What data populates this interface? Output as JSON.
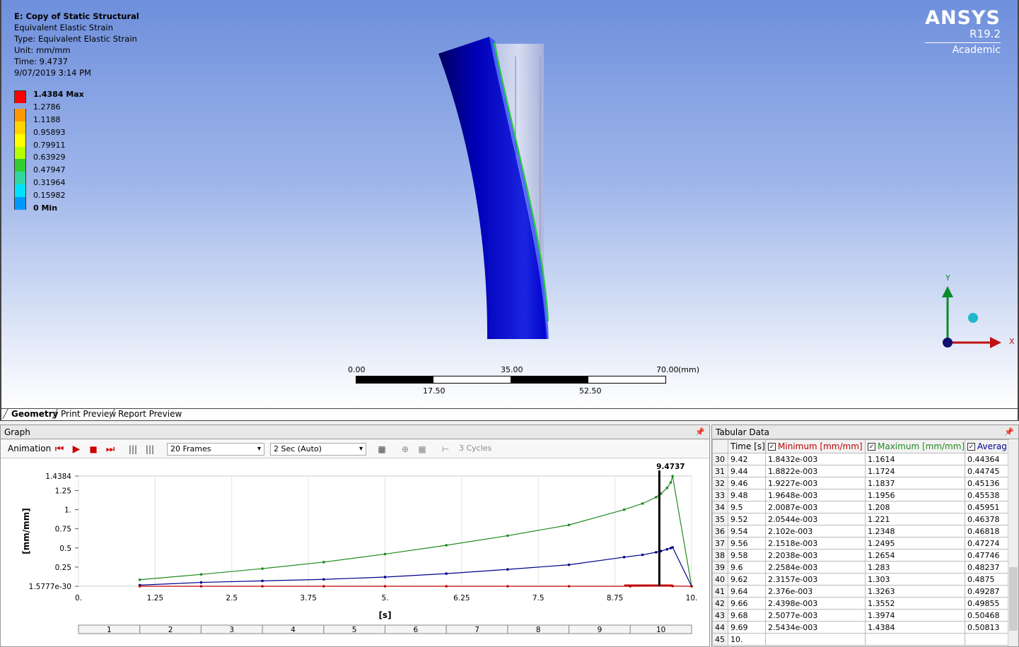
{
  "viewport": {
    "title": "E: Copy of Static Structural",
    "result": "Equivalent Elastic Strain",
    "type": "Type: Equivalent Elastic Strain",
    "unit": "Unit: mm/mm",
    "time": "Time: 9.4737",
    "date": "9/07/2019 3:14 PM",
    "legend": [
      {
        "label": "1.4384 Max",
        "color": "#ff0000",
        "bold": true
      },
      {
        "label": "1.2786",
        "color": "#ff9900"
      },
      {
        "label": "1.1188",
        "color": "#ffd400"
      },
      {
        "label": "0.95893",
        "color": "#ffff00"
      },
      {
        "label": "0.79911",
        "color": "#b4ff00"
      },
      {
        "label": "0.63929",
        "color": "#33cc33"
      },
      {
        "label": "0.47947",
        "color": "#33d6a3"
      },
      {
        "label": "0.31964",
        "color": "#00e1ff"
      },
      {
        "label": "0.15982",
        "color": "#0099ff"
      },
      {
        "label": "0 Min",
        "color": "#0000ff",
        "bold": true
      }
    ],
    "logo": {
      "name": "ANSYS",
      "version": "R19.2",
      "edition": "Academic"
    },
    "scale": {
      "t0": "0.00",
      "t1": "35.00",
      "t2": "70.00",
      "unit": "(mm)",
      "b1": "17.50",
      "b2": "52.50"
    },
    "triad": {
      "y": "Y",
      "x": "X"
    }
  },
  "tabs": [
    "Geometry",
    "Print Preview",
    "Report Preview"
  ],
  "graph": {
    "title": "Graph",
    "animation_label": "Animation",
    "frames": "20 Frames",
    "speed": "2 Sec (Auto)",
    "cycles": "3 Cycles",
    "cursor_label": "9.4737",
    "ylabel": "[mm/mm]",
    "xlabel": "[s]",
    "steps": [
      "1",
      "2",
      "3",
      "4",
      "5",
      "6",
      "7",
      "8",
      "9",
      "10"
    ]
  },
  "chart_data": {
    "type": "line",
    "xlabel": "[s]",
    "ylabel": "[mm/mm]",
    "xlim": [
      0,
      10
    ],
    "ylim": [
      0,
      1.4384
    ],
    "x_ticks": [
      "0.",
      "1.25",
      "2.5",
      "3.75",
      "5.",
      "6.25",
      "7.5",
      "8.75",
      "10."
    ],
    "y_ticks": [
      "1.5777e-30",
      "0.25",
      "0.5",
      "0.75",
      "1.",
      "1.25",
      "1.4384"
    ],
    "cursor_x": 9.4737,
    "series": [
      {
        "name": "Maximum [mm/mm]",
        "color": "#1f8a1f",
        "x": [
          1,
          2,
          3,
          4,
          5,
          6,
          7,
          8,
          8.9,
          9.2,
          9.42,
          9.5,
          9.6,
          9.66,
          9.69,
          10
        ],
        "y": [
          0.085,
          0.155,
          0.23,
          0.315,
          0.42,
          0.535,
          0.66,
          0.8,
          1.0,
          1.08,
          1.1614,
          1.208,
          1.283,
          1.3552,
          1.4384,
          0.0
        ]
      },
      {
        "name": "Average",
        "color": "#00008b",
        "x": [
          1,
          2,
          3,
          4,
          5,
          6,
          7,
          8,
          8.9,
          9.2,
          9.42,
          9.5,
          9.6,
          9.66,
          9.69,
          10
        ],
        "y": [
          0.015,
          0.05,
          0.07,
          0.09,
          0.12,
          0.165,
          0.22,
          0.28,
          0.38,
          0.41,
          0.44364,
          0.45951,
          0.48237,
          0.49855,
          0.50813,
          0.0
        ]
      },
      {
        "name": "Minimum [mm/mm]",
        "color": "#c00000",
        "x": [
          1,
          2,
          3,
          4,
          5,
          6,
          7,
          8,
          9,
          9.69,
          10
        ],
        "y": [
          0.0,
          0.0,
          0.0,
          0.0,
          0.0,
          0.0,
          0.0,
          0.0,
          0.0,
          0.0025,
          0.0
        ]
      }
    ]
  },
  "table": {
    "title": "Tabular Data",
    "headers": [
      "Time [s]",
      "Minimum [mm/mm]",
      "Maximum [mm/mm]",
      "Averag"
    ],
    "header_colors": [
      "#000000",
      "#c00000",
      "#1f8a1f",
      "#00008b"
    ],
    "rows": [
      [
        "30",
        "9.42",
        "1.8432e-003",
        "1.1614",
        "0.44364"
      ],
      [
        "31",
        "9.44",
        "1.8822e-003",
        "1.1724",
        "0.44745"
      ],
      [
        "32",
        "9.46",
        "1.9227e-003",
        "1.1837",
        "0.45136"
      ],
      [
        "33",
        "9.48",
        "1.9648e-003",
        "1.1956",
        "0.45538"
      ],
      [
        "34",
        "9.5",
        "2.0087e-003",
        "1.208",
        "0.45951"
      ],
      [
        "35",
        "9.52",
        "2.0544e-003",
        "1.221",
        "0.46378"
      ],
      [
        "36",
        "9.54",
        "2.102e-003",
        "1.2348",
        "0.46818"
      ],
      [
        "37",
        "9.56",
        "2.1518e-003",
        "1.2495",
        "0.47274"
      ],
      [
        "38",
        "9.58",
        "2.2038e-003",
        "1.2654",
        "0.47746"
      ],
      [
        "39",
        "9.6",
        "2.2584e-003",
        "1.283",
        "0.48237"
      ],
      [
        "40",
        "9.62",
        "2.3157e-003",
        "1.303",
        "0.4875"
      ],
      [
        "41",
        "9.64",
        "2.376e-003",
        "1.3263",
        "0.49287"
      ],
      [
        "42",
        "9.66",
        "2.4398e-003",
        "1.3552",
        "0.49855"
      ],
      [
        "43",
        "9.68",
        "2.5077e-003",
        "1.3974",
        "0.50468"
      ],
      [
        "44",
        "9.69",
        "2.5434e-003",
        "1.4384",
        "0.50813"
      ],
      [
        "45",
        "10.",
        "",
        "",
        ""
      ]
    ]
  }
}
